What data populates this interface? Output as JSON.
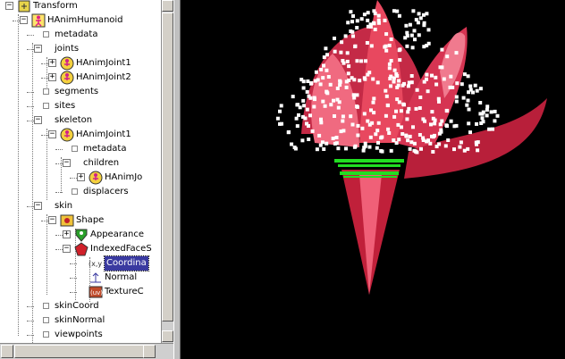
{
  "tree": {
    "nodes": [
      {
        "label": "Transform",
        "indent": 0,
        "toggle": "minus",
        "icon": "transform-icon"
      },
      {
        "label": "HAnimHumanoid",
        "indent": 1,
        "toggle": "minus",
        "icon": "humanoid-icon"
      },
      {
        "label": "metadata",
        "indent": 2,
        "toggle": "leaf",
        "icon": ""
      },
      {
        "label": "joints",
        "indent": 2,
        "toggle": "minus",
        "icon": ""
      },
      {
        "label": "HAnimJoint1",
        "indent": 3,
        "toggle": "plus",
        "icon": "joint-icon"
      },
      {
        "label": "HAnimJoint2",
        "indent": 3,
        "toggle": "plus",
        "icon": "joint-icon"
      },
      {
        "label": "segments",
        "indent": 2,
        "toggle": "leaf",
        "icon": ""
      },
      {
        "label": "sites",
        "indent": 2,
        "toggle": "leaf",
        "icon": ""
      },
      {
        "label": "skeleton",
        "indent": 2,
        "toggle": "minus",
        "icon": ""
      },
      {
        "label": "HAnimJoint1",
        "indent": 3,
        "toggle": "minus",
        "icon": "joint-icon"
      },
      {
        "label": "metadata",
        "indent": 4,
        "toggle": "leaf",
        "icon": ""
      },
      {
        "label": "children",
        "indent": 4,
        "toggle": "minus",
        "icon": ""
      },
      {
        "label": "HAnimJo",
        "indent": 5,
        "toggle": "plus",
        "icon": "joint-icon"
      },
      {
        "label": "displacers",
        "indent": 4,
        "toggle": "leaf",
        "icon": ""
      },
      {
        "label": "skin",
        "indent": 2,
        "toggle": "minus",
        "icon": ""
      },
      {
        "label": "Shape",
        "indent": 3,
        "toggle": "minus",
        "icon": "shape-icon"
      },
      {
        "label": "Appearance",
        "indent": 4,
        "toggle": "plus",
        "icon": "appearance-icon"
      },
      {
        "label": "IndexedFaceS",
        "indent": 4,
        "toggle": "minus",
        "icon": "indexedfaceset-icon"
      },
      {
        "label": "Coordina",
        "indent": 5,
        "toggle": "none",
        "icon": "coordinate-icon",
        "selected": true
      },
      {
        "label": "Normal",
        "indent": 5,
        "toggle": "none",
        "icon": "normal-icon"
      },
      {
        "label": "TextureC",
        "indent": 5,
        "toggle": "none",
        "icon": "texturecoordinate-icon"
      },
      {
        "label": "skinCoord",
        "indent": 2,
        "toggle": "leaf",
        "icon": ""
      },
      {
        "label": "skinNormal",
        "indent": 2,
        "toggle": "leaf",
        "icon": ""
      },
      {
        "label": "viewpoints",
        "indent": 2,
        "toggle": "leaf",
        "icon": ""
      }
    ]
  },
  "colors": {
    "selection": "#3a3aa0",
    "petal": "#d8304f",
    "points": "#ffffff",
    "normals": "#22dd22",
    "background": "#000000"
  }
}
